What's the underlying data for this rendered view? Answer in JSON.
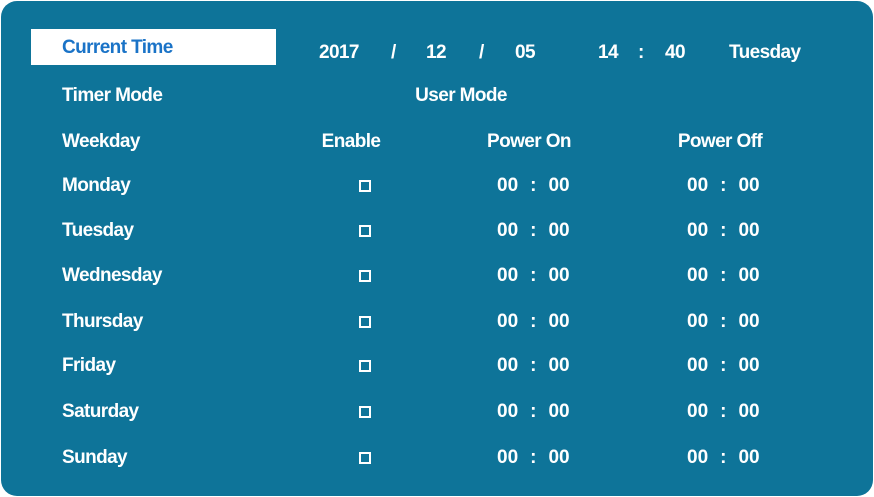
{
  "current_time": {
    "label": "Current Time",
    "year": "2017",
    "sep1": "/",
    "month": "12",
    "sep2": "/",
    "day": "05",
    "hour": "14",
    "colon": ":",
    "minute": "40",
    "weekday": "Tuesday"
  },
  "timer_mode": {
    "label": "Timer Mode",
    "value": "User Mode"
  },
  "headers": {
    "weekday": "Weekday",
    "enable": "Enable",
    "power_on": "Power On",
    "power_off": "Power Off"
  },
  "rows": [
    {
      "day": "Monday",
      "enabled": false,
      "on_h": "00",
      "on_m": "00",
      "off_h": "00",
      "off_m": "00"
    },
    {
      "day": "Tuesday",
      "enabled": false,
      "on_h": "00",
      "on_m": "00",
      "off_h": "00",
      "off_m": "00"
    },
    {
      "day": "Wednesday",
      "enabled": false,
      "on_h": "00",
      "on_m": "00",
      "off_h": "00",
      "off_m": "00"
    },
    {
      "day": "Thursday",
      "enabled": false,
      "on_h": "00",
      "on_m": "00",
      "off_h": "00",
      "off_m": "00"
    },
    {
      "day": "Friday",
      "enabled": false,
      "on_h": "00",
      "on_m": "00",
      "off_h": "00",
      "off_m": "00"
    },
    {
      "day": "Saturday",
      "enabled": false,
      "on_h": "00",
      "on_m": "00",
      "off_h": "00",
      "off_m": "00"
    },
    {
      "day": "Sunday",
      "enabled": false,
      "on_h": "00",
      "on_m": "00",
      "off_h": "00",
      "off_m": "00"
    }
  ],
  "time_sep": ":",
  "colors": {
    "panel": "#0e7499",
    "text": "#ffffff",
    "selected_text": "#1a73c7"
  }
}
